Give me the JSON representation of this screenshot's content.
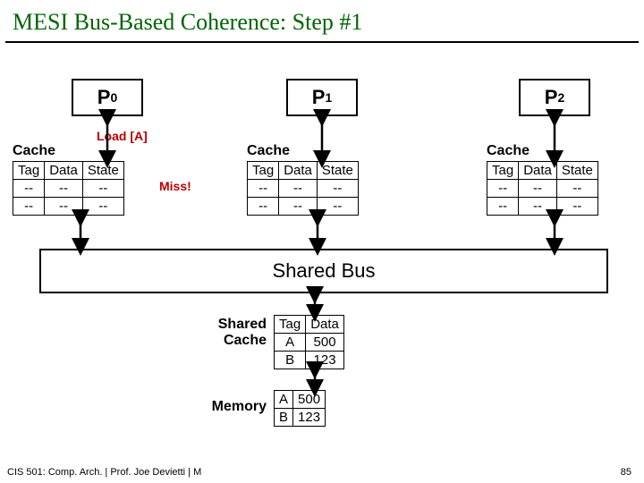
{
  "title": "MESI Bus-Based Coherence: Step #1",
  "processors": {
    "p0": "P",
    "p0s": "0",
    "p1": "P",
    "p1s": "1",
    "p2": "P",
    "p2s": "2"
  },
  "load_label": "Load [A]",
  "miss_label": "Miss!",
  "cache_label": "Cache",
  "cache_headers": {
    "tag": "Tag",
    "data": "Data",
    "state": "State"
  },
  "cache0": [
    [
      "--",
      "--",
      "--"
    ],
    [
      "--",
      "--",
      "--"
    ]
  ],
  "cache1": [
    [
      "--",
      "--",
      "--"
    ],
    [
      "--",
      "--",
      "--"
    ]
  ],
  "cache2": [
    [
      "--",
      "--",
      "--"
    ],
    [
      "--",
      "--",
      "--"
    ]
  ],
  "bus_label": "Shared Bus",
  "shared_cache_label_a": "Shared",
  "shared_cache_label_b": "Cache",
  "shared_headers": {
    "tag": "Tag",
    "data": "Data"
  },
  "shared_cache": [
    [
      "A",
      "500"
    ],
    [
      "B",
      "123"
    ]
  ],
  "memory_label": "Memory",
  "memory": [
    [
      "A",
      "500"
    ],
    [
      "B",
      "123"
    ]
  ],
  "footer_left": "CIS 501: Comp. Arch.  |  Prof. Joe Devietti  |  M",
  "footer_right": "85"
}
